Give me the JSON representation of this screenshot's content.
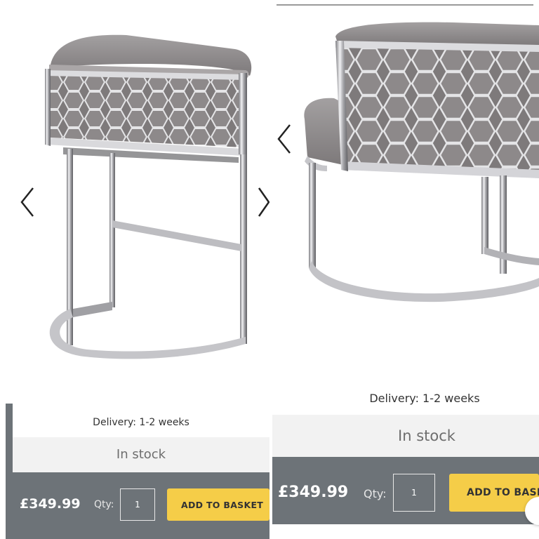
{
  "colors": {
    "accent_button": "#f5cd48",
    "buy_bar": "#6d7378",
    "stock_bg": "#f2f2f2",
    "chair_upholstery": "#8f8b8c",
    "chrome": "#c9c9cc"
  },
  "left_panel": {
    "product_image": "grey-velvet-honeycomb-chrome-bar-stool",
    "prev_icon": "chevron-left-icon",
    "next_icon": "chevron-right-icon",
    "delivery": "Delivery: 1-2 weeks",
    "stock": "In stock",
    "price": "£349.99",
    "qty_label": "Qty:",
    "qty_value": "1",
    "add_to_basket": "ADD TO BASKET"
  },
  "right_panel": {
    "product_image": "grey-velvet-honeycomb-chrome-chair",
    "prev_icon": "chevron-left-icon",
    "delivery": "Delivery: 1-2 weeks",
    "stock": "In stock",
    "price": "£349.99",
    "qty_label": "Qty:",
    "qty_value": "1",
    "add_to_basket": "ADD TO BASKET"
  }
}
